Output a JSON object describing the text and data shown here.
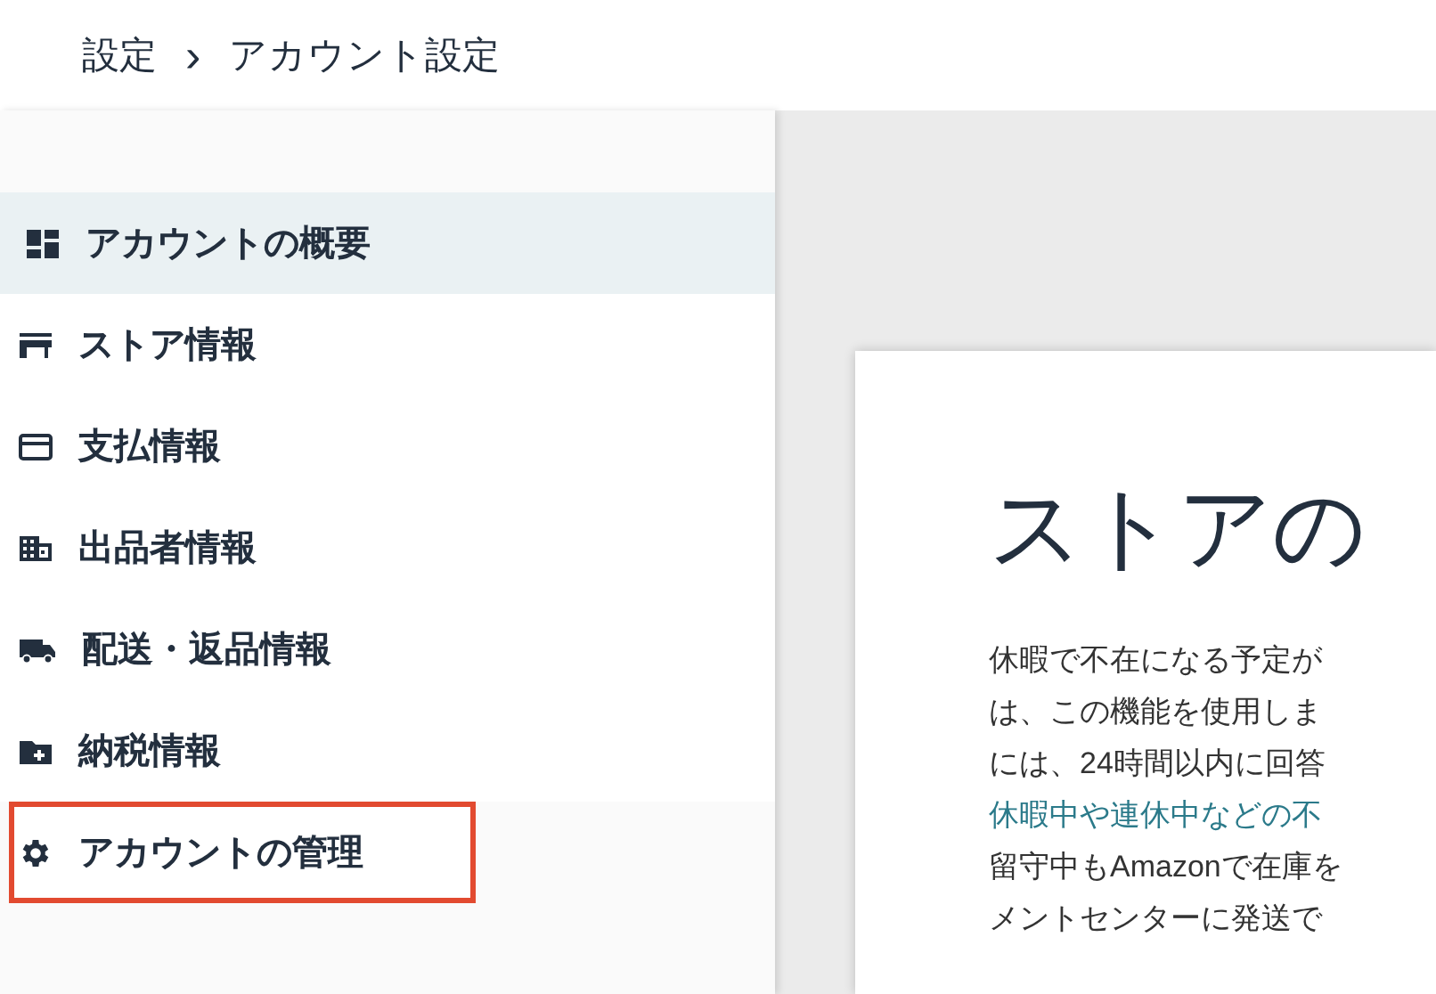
{
  "breadcrumb": {
    "items": [
      "設定",
      "アカウント設定"
    ],
    "separator": "›"
  },
  "sidebar": {
    "items": [
      {
        "label": "アカウントの概要",
        "selected": true,
        "highlighted": false
      },
      {
        "label": "ストア情報",
        "selected": false,
        "highlighted": false
      },
      {
        "label": "支払情報",
        "selected": false,
        "highlighted": false
      },
      {
        "label": "出品者情報",
        "selected": false,
        "highlighted": false
      },
      {
        "label": "配送・返品情報",
        "selected": false,
        "highlighted": false
      },
      {
        "label": "納税情報",
        "selected": false,
        "highlighted": false
      },
      {
        "label": "アカウントの管理",
        "selected": false,
        "highlighted": true
      }
    ]
  },
  "card": {
    "title": "ストアの",
    "lines": [
      {
        "kind": "text",
        "text": "休暇で不在になる予定が"
      },
      {
        "kind": "text",
        "text": "は、この機能を使用しま"
      },
      {
        "kind": "text",
        "text": "には、24時間以内に回答"
      },
      {
        "kind": "link",
        "text": "休暇中や連休中などの不"
      },
      {
        "kind": "text",
        "text": "留守中もAmazonで在庫を"
      },
      {
        "kind": "text",
        "text": "メントセンターに発送で"
      }
    ]
  }
}
